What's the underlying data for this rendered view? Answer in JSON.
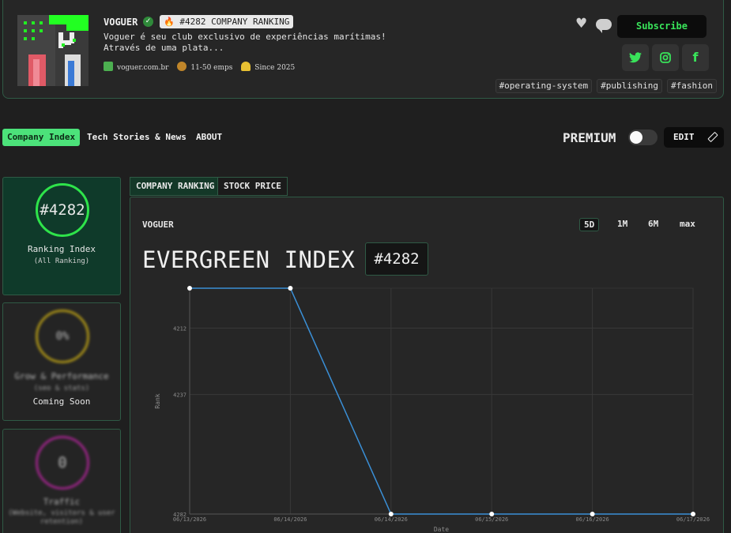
{
  "header": {
    "company_name": "VOGUER",
    "rank_badge": "#4282 COMPANY RANKING",
    "description": "Voguer é seu club exclusivo de experiências marítimas! Através de uma plata...",
    "meta": {
      "website": "voguer.com.br",
      "employees": "11-50 emps",
      "since": "Since 2025"
    },
    "subscribe_label": "Subscribe",
    "tags": [
      "#operating-system",
      "#publishing",
      "#fashion"
    ]
  },
  "nav": {
    "tabs": [
      "Company Index",
      "Tech Stories & News",
      "ABOUT"
    ],
    "premium_label": "PREMIUM",
    "edit_label": "EDIT"
  },
  "stats": [
    {
      "value": "#4282",
      "title": "Ranking Index",
      "sub": "(All Ranking)",
      "color": "#2ee34a"
    },
    {
      "value": "0%",
      "title": "Grow & Performance",
      "sub": "(seo & stats)",
      "note": "Coming Soon",
      "color": "#d4b514"
    },
    {
      "value": "0",
      "title": "Traffic",
      "sub": "(Website, visitors & user retention)",
      "color": "#c026a6"
    }
  ],
  "chart_tabs": [
    "COMPANY RANKING",
    "STOCK PRICE"
  ],
  "panel": {
    "company": "VOGUER",
    "ranges": [
      "5D",
      "1M",
      "6M",
      "max"
    ],
    "title": "EVERGREEN INDEX",
    "badge": "#4282"
  },
  "chart_data": {
    "type": "line",
    "x": [
      "06/13/2026",
      "06/14/2026",
      "06/14/2026",
      "06/15/2026",
      "06/16/2026",
      "06/17/2026"
    ],
    "y": [
      4197,
      4197,
      4282,
      4282,
      4282,
      4282
    ],
    "y_ticks": [
      4212,
      4237,
      4282
    ],
    "ylim": [
      4197,
      4282
    ],
    "y_inverted": true,
    "xlabel": "Date",
    "ylabel": "Rank",
    "line_color": "#3a8fd6",
    "grid": true
  }
}
